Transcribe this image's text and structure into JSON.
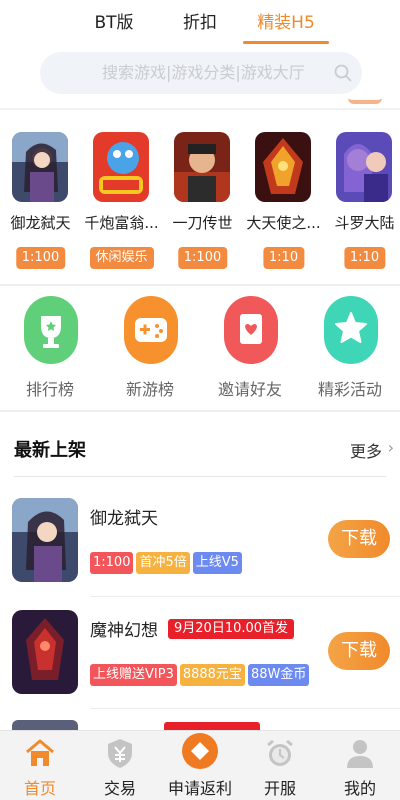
{
  "top_tabs": [
    {
      "label": "BT版",
      "active": false
    },
    {
      "label": "折扣",
      "active": false
    },
    {
      "label": "精装H5",
      "active": true
    }
  ],
  "search": {
    "placeholder": "搜索游戏|游戏分类|游戏大厅",
    "icon": "search-icon"
  },
  "hot_games": [
    {
      "name": "御龙弑天",
      "badge": "1:100"
    },
    {
      "name": "千炮富翁...",
      "badge": "休闲娱乐"
    },
    {
      "name": "一刀传世",
      "badge": "1:100"
    },
    {
      "name": "大天使之...",
      "badge": "1:10"
    },
    {
      "name": "斗罗大陆",
      "badge": "1:10"
    }
  ],
  "quick_entries": [
    {
      "label": "排行榜",
      "icon": "trophy-icon",
      "color": "#5fcf7a"
    },
    {
      "label": "新游榜",
      "icon": "gamepad-icon",
      "color": "#f7912e"
    },
    {
      "label": "邀请好友",
      "icon": "card-icon",
      "color": "#f0585a"
    },
    {
      "label": "精彩活动",
      "icon": "star-icon",
      "color": "#3fd6b8"
    }
  ],
  "newest": {
    "title": "最新上架",
    "more": "更多",
    "games": [
      {
        "name": "御龙弑天",
        "date_tag": "",
        "tags": [
          {
            "text": "1:100",
            "color": "red"
          },
          {
            "text": "首冲5倍",
            "color": "orange"
          },
          {
            "text": "上线V5",
            "color": "blue"
          }
        ],
        "button": "下载"
      },
      {
        "name": "魔神幻想",
        "date_tag": "9月20日10.00首发",
        "tags": [
          {
            "text": "上线赠送VIP3",
            "color": "red"
          },
          {
            "text": "8888元宝",
            "color": "orange"
          },
          {
            "text": "88W金币",
            "color": "blue"
          }
        ],
        "button": "下载"
      }
    ]
  },
  "bottom_nav": [
    {
      "label": "首页",
      "icon": "home-icon",
      "active": true
    },
    {
      "label": "交易",
      "icon": "shield-yen-icon",
      "active": false
    },
    {
      "label": "申请返利",
      "icon": "rebate-icon",
      "active": false
    },
    {
      "label": "开服",
      "icon": "alarm-clock-icon",
      "active": false
    },
    {
      "label": "我的",
      "icon": "user-icon",
      "active": false
    }
  ],
  "colors": {
    "accent": "#f08a2c",
    "badge": "#f28b40",
    "date_tag": "#e8202a"
  }
}
